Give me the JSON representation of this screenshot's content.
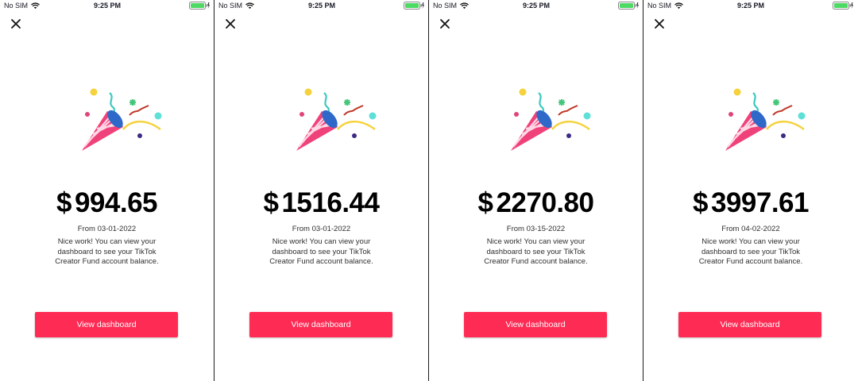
{
  "colors": {
    "accent": "#fe2c55",
    "battery": "#4cd964",
    "text": "#161823"
  },
  "screens": [
    {
      "status": {
        "carrier": "No SIM",
        "time": "9:25 PM"
      },
      "amount": {
        "currency": "$",
        "value": "994.65"
      },
      "from": "From 03-01-2022",
      "message": "Nice work! You can view your dashboard to see your TikTok Creator Fund account balance.",
      "button_label": "View dashboard",
      "icons": [
        "close-icon",
        "confetti-icon",
        "wifi-icon",
        "battery-icon"
      ]
    },
    {
      "status": {
        "carrier": "No SIM",
        "time": "9:25 PM"
      },
      "amount": {
        "currency": "$",
        "value": "1516.44"
      },
      "from": "From 03-01-2022",
      "message": "Nice work! You can view your dashboard to see your TikTok Creator Fund account balance.",
      "button_label": "View dashboard",
      "icons": [
        "close-icon",
        "confetti-icon",
        "wifi-icon",
        "battery-icon"
      ]
    },
    {
      "status": {
        "carrier": "No SIM",
        "time": "9:25 PM"
      },
      "amount": {
        "currency": "$",
        "value": "2270.80"
      },
      "from": "From 03-15-2022",
      "message": "Nice work! You can view your dashboard to see your TikTok Creator Fund account balance.",
      "button_label": "View dashboard",
      "icons": [
        "close-icon",
        "confetti-icon",
        "wifi-icon",
        "battery-icon"
      ]
    },
    {
      "status": {
        "carrier": "No SIM",
        "time": "9:25 PM"
      },
      "amount": {
        "currency": "$",
        "value": "3997.61"
      },
      "from": "From 04-02-2022",
      "message": "Nice work! You can view your dashboard to see your TikTok Creator Fund account balance.",
      "button_label": "View dashboard",
      "icons": [
        "close-icon",
        "confetti-icon",
        "wifi-icon",
        "battery-icon"
      ]
    }
  ]
}
